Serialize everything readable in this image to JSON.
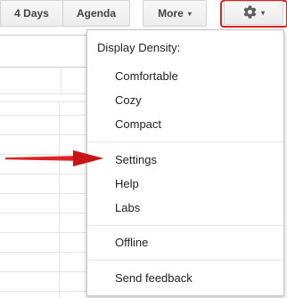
{
  "toolbar": {
    "four_days_label": "4 Days",
    "agenda_label": "Agenda",
    "more_label": "More",
    "more_caret": "▾",
    "settings_icon": "gear-icon",
    "settings_caret": "▾"
  },
  "menu": {
    "heading": "Display Density:",
    "density_options": [
      "Comfortable",
      "Cozy",
      "Compact"
    ],
    "settings": "Settings",
    "help": "Help",
    "labs": "Labs",
    "offline": "Offline",
    "send_feedback": "Send feedback"
  },
  "colors": {
    "highlight": "#e02020",
    "arrow": "#e02020"
  }
}
